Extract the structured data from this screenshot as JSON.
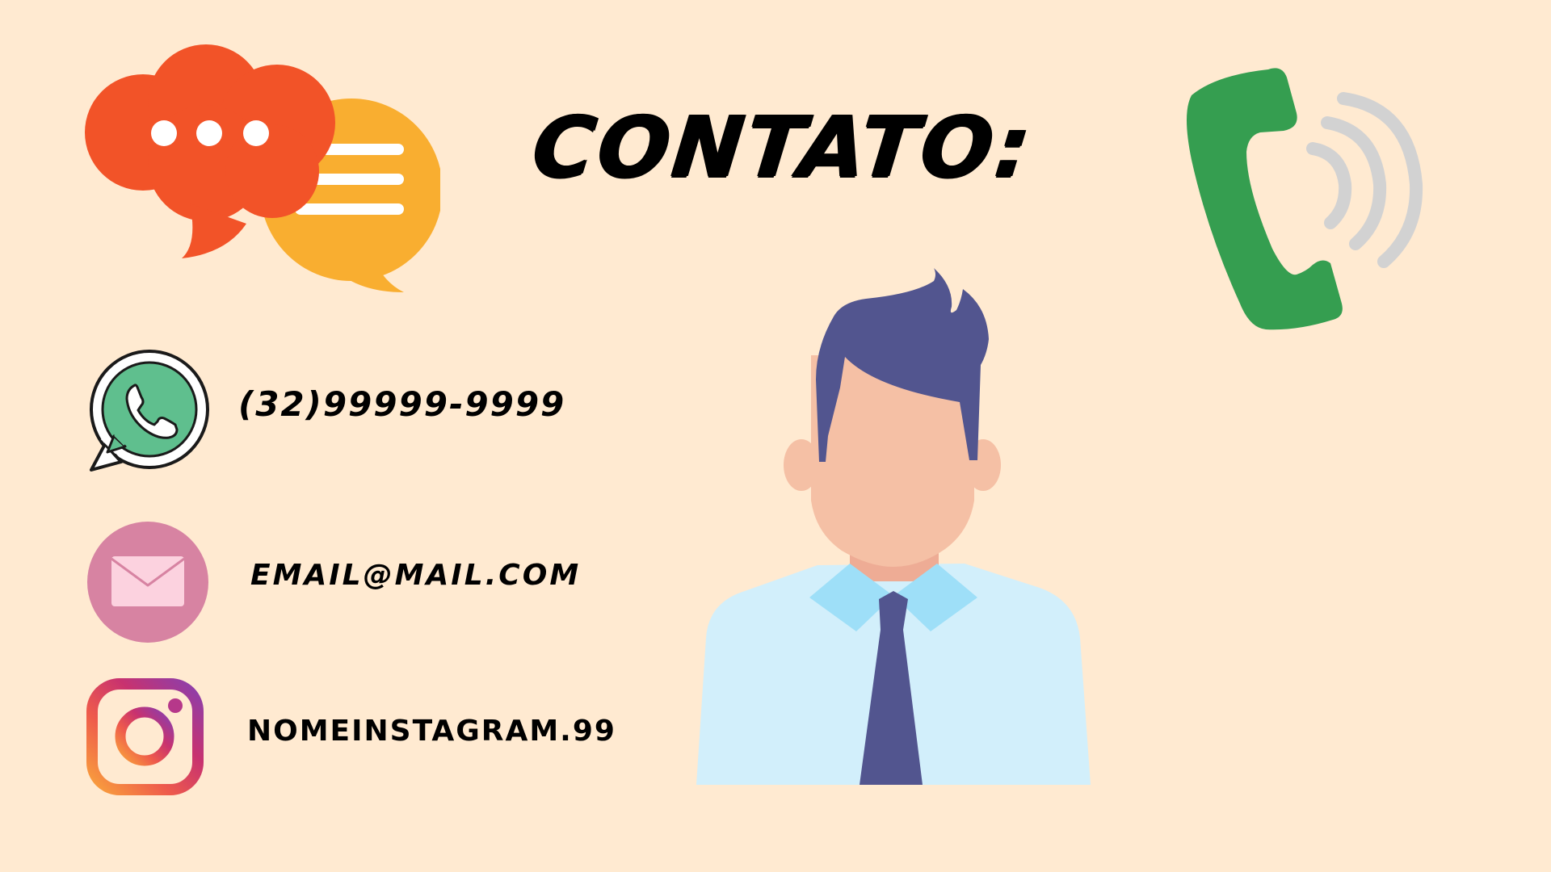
{
  "title": "CONTATO:",
  "contacts": {
    "phone": "(32)99999-9999",
    "email": "EMAIL@MAIL.COM",
    "instagram": "NOMEINSTAGRAM.99"
  },
  "icons": {
    "chat": "speech-bubbles-icon",
    "whatsapp": "whatsapp-icon",
    "email": "envelope-icon",
    "instagram": "instagram-icon",
    "phone": "phone-ringing-icon",
    "person": "businessman-avatar"
  },
  "colors": {
    "background": "#ffead1",
    "chat_red": "#f25328",
    "chat_orange": "#f9ae30",
    "whatsapp_green": "#5fbf8e",
    "email_pink": "#d783a2",
    "phone_green": "#359e50",
    "hair": "#52558f",
    "skin": "#f5c0a5",
    "shirt": "#d2effb",
    "collar": "#9edff8"
  }
}
